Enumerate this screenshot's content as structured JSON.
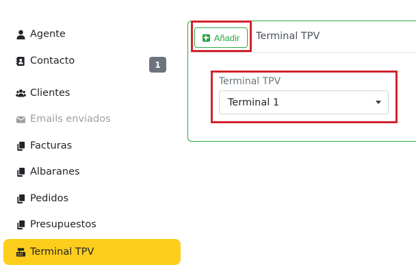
{
  "sidebar": {
    "items": [
      {
        "label": "Agente",
        "icon": "user-icon"
      },
      {
        "label": "Contacto",
        "icon": "contact-card-icon",
        "badge": "1"
      },
      {
        "label": "Clientes",
        "icon": "users-icon"
      },
      {
        "label": "Emails enviados",
        "icon": "envelope-icon",
        "disabled": true
      },
      {
        "label": "Facturas",
        "icon": "copy-icon"
      },
      {
        "label": "Albaranes",
        "icon": "copy-icon"
      },
      {
        "label": "Pedidos",
        "icon": "copy-icon"
      },
      {
        "label": "Presupuestos",
        "icon": "copy-icon"
      },
      {
        "label": "Terminal TPV",
        "icon": "cash-register-icon",
        "active": true
      }
    ]
  },
  "panel": {
    "add_label": "Añadir",
    "title": "Terminal TPV",
    "field_label": "Terminal TPV",
    "select_value": "Terminal 1"
  },
  "colors": {
    "active_bg": "#fdcd1c",
    "success": "#28a745",
    "highlight": "#d3222d",
    "badge": "#6c757d"
  }
}
